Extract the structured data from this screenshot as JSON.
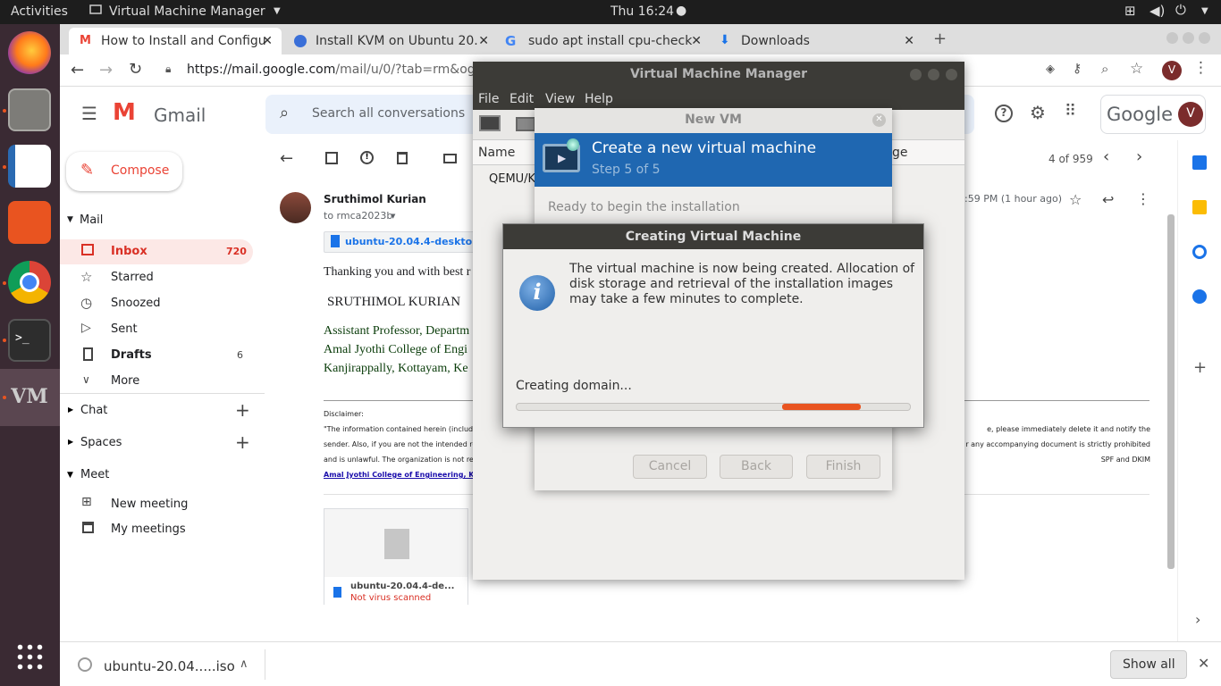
{
  "topbar": {
    "activities": "Activities",
    "app_menu": "Virtual Machine Manager",
    "clock": "Thu 16:24"
  },
  "dock": {
    "icons": [
      "firefox-icon",
      "files-icon",
      "writer-icon",
      "software-icon",
      "chrome-icon",
      "terminal-icon",
      "virt-manager-icon",
      "apps-grid-icon"
    ]
  },
  "browser": {
    "tabs": [
      {
        "label": "How to Install and Configu",
        "icon": "gmail-icon"
      },
      {
        "label": "Install KVM on Ubuntu 20.",
        "icon": "globe-icon"
      },
      {
        "label": "sudo apt install cpu-check",
        "icon": "google-icon"
      },
      {
        "label": "Downloads",
        "icon": "download-icon"
      }
    ],
    "url_host": "https://mail.google.com",
    "url_path": "/mail/u/0/?tab=rm&ogbl#in",
    "profile_initial": "V"
  },
  "gmail": {
    "logo": "Gmail",
    "search_placeholder": "Search all conversations",
    "compose": "Compose",
    "mail_header": "Mail",
    "nav": [
      {
        "label": "Inbox",
        "count": "720"
      },
      {
        "label": "Starred",
        "count": ""
      },
      {
        "label": "Snoozed",
        "count": ""
      },
      {
        "label": "Sent",
        "count": ""
      },
      {
        "label": "Drafts",
        "count": "6"
      },
      {
        "label": "More",
        "count": ""
      }
    ],
    "chat": "Chat",
    "spaces": "Spaces",
    "meet": "Meet",
    "new_meeting": "New meeting",
    "my_meetings": "My meetings",
    "pager": "4 of 959",
    "google_word": "Google",
    "sender": "Sruthimol Kurian",
    "to": "to rmca2023b",
    "time": ":59 PM (1 hour ago)",
    "attachment_chip": "ubuntu-20.04.4-desktop-ar",
    "body_line": "Thanking you and with best r",
    "signature_name": "SRUTHIMOL KURIAN",
    "sig1": "Assistant Professor, Departm",
    "sig2": "Amal Jyothi College of Engi",
    "sig3": "Kanjirappally, Kottayam, Ke",
    "disclaimer_title": "Disclaimer:",
    "disc1": "\"The information contained herein (includi",
    "disc2": "sender. Also, if you are not the intended re",
    "disc3": "and is unlawful. The organization is not re",
    "disc_link": "Amal Jyothi College of Engineering, Ka",
    "disc_r1": "e, please immediately delete it and notify the",
    "disc_r2": "r any accompanying document is strictly prohibited",
    "disc_r3": "SPF and DKIM",
    "attach_name": "ubuntu-20.04.4-de...",
    "attach_status": "Not virus scanned"
  },
  "download_bar": {
    "file": "ubuntu-20.04.....iso",
    "show_all": "Show all"
  },
  "vmm": {
    "title": "Virtual Machine Manager",
    "menus": [
      "File",
      "Edit",
      "View",
      "Help"
    ],
    "col_name": "Name",
    "col_usage": "ge",
    "row": "QEMU/K"
  },
  "newvm": {
    "title": "New VM",
    "header": "Create a new virtual machine",
    "step": "Step 5 of 5",
    "ready": "Ready to begin the installation",
    "cancel": "Cancel",
    "back": "Back",
    "finish": "Finish"
  },
  "dialog": {
    "title": "Creating Virtual Machine",
    "message": "The virtual machine is now being created. Allocation of disk storage and retrieval of the installation images may take a few minutes to complete.",
    "status": "Creating domain...",
    "accent": "#e95420"
  }
}
